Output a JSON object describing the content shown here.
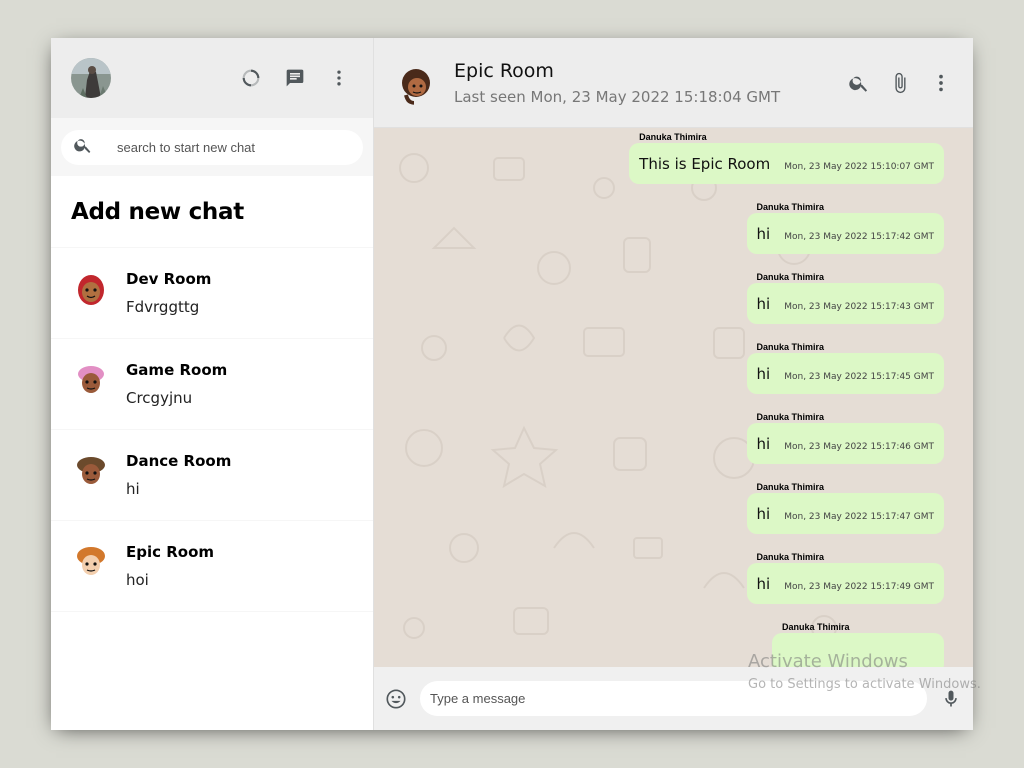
{
  "sidebar": {
    "search": {
      "placeholder": "search to start new chat"
    },
    "add_chat_label": "Add new chat",
    "chats": [
      {
        "name": "Dev Room",
        "last_message": "Fdvrggttg",
        "avatar": "cartoon-avatar-red-hair"
      },
      {
        "name": "Game Room",
        "last_message": "Crcgyjnu",
        "avatar": "cartoon-avatar-pink-hair"
      },
      {
        "name": "Dance Room",
        "last_message": "hi",
        "avatar": "cartoon-avatar-brown-hair"
      },
      {
        "name": "Epic Room",
        "last_message": "hoi",
        "avatar": "cartoon-avatar-orange-hair"
      }
    ]
  },
  "chat": {
    "title": "Epic Room",
    "last_seen": "Last seen Mon, 23 May 2022 15:18:04 GMT",
    "messages": [
      {
        "sender": "Danuka Thimira",
        "text": "This is Epic Room",
        "time": "Mon, 23 May 2022 15:10:07 GMT"
      },
      {
        "sender": "Danuka Thimira",
        "text": "hi",
        "time": "Mon, 23 May 2022 15:17:42 GMT"
      },
      {
        "sender": "Danuka Thimira",
        "text": "hi",
        "time": "Mon, 23 May 2022 15:17:43 GMT"
      },
      {
        "sender": "Danuka Thimira",
        "text": "hi",
        "time": "Mon, 23 May 2022 15:17:45 GMT"
      },
      {
        "sender": "Danuka Thimira",
        "text": "hi",
        "time": "Mon, 23 May 2022 15:17:46 GMT"
      },
      {
        "sender": "Danuka Thimira",
        "text": "hi",
        "time": "Mon, 23 May 2022 15:17:47 GMT"
      },
      {
        "sender": "Danuka Thimira",
        "text": "hi",
        "time": "Mon, 23 May 2022 15:17:49 GMT"
      },
      {
        "sender": "Danuka Thimira",
        "text": "",
        "time": ""
      }
    ],
    "input_placeholder": "Type a message"
  },
  "watermark": {
    "line1": "Activate Windows",
    "line2": "Go to Settings to activate Windows."
  },
  "colors": {
    "app_bg": "#dadbd3",
    "header_bg": "#ededed",
    "chat_bg": "#e5ddd5",
    "bubble_bg": "#dcf8c6"
  },
  "icons": {
    "status": "status-icon",
    "new_chat": "chat-icon",
    "menu": "more-vert-icon",
    "search": "search-icon",
    "attach": "attach-icon",
    "emoji": "emoji-icon",
    "mic": "mic-icon"
  }
}
